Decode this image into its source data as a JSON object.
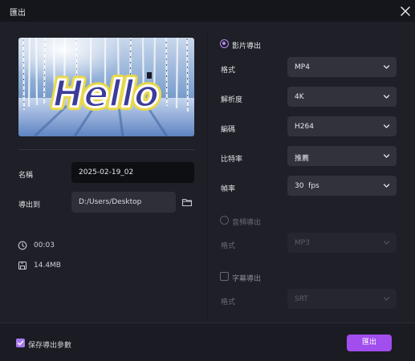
{
  "window": {
    "title": "匯出"
  },
  "preview": {
    "text": "Hello"
  },
  "left": {
    "name_label": "名稱",
    "name_value": "2025-02-19_02",
    "export_to_label": "導出到",
    "path_value": "D:/Users/Desktop",
    "duration": "00:03",
    "filesize": "14.4MB"
  },
  "video_section": {
    "title": "影片導出",
    "selected": true,
    "fields": [
      {
        "label": "格式",
        "value": "MP4"
      },
      {
        "label": "解析度",
        "value": "4K"
      },
      {
        "label": "編碼",
        "value": "H264"
      },
      {
        "label": "比特率",
        "value": "推薦"
      },
      {
        "label": "幀率",
        "value": "30  fps"
      }
    ]
  },
  "audio_section": {
    "title": "音頻導出",
    "selected": false,
    "format_label": "格式",
    "format_value": "MP3"
  },
  "subtitle_section": {
    "title": "字幕導出",
    "checked": false,
    "format_label": "格式",
    "format_value": "SRT"
  },
  "footer": {
    "save_params_label": "保存導出參數",
    "save_params_checked": true,
    "export_button": "匯出"
  },
  "colors": {
    "accent": "#a24ded",
    "radio": "#b78cf2",
    "background": "#1e1f27"
  },
  "icons": [
    "close-icon",
    "folder-icon",
    "clock-icon",
    "save-disk-icon",
    "chevron-down-icon",
    "check-icon"
  ]
}
